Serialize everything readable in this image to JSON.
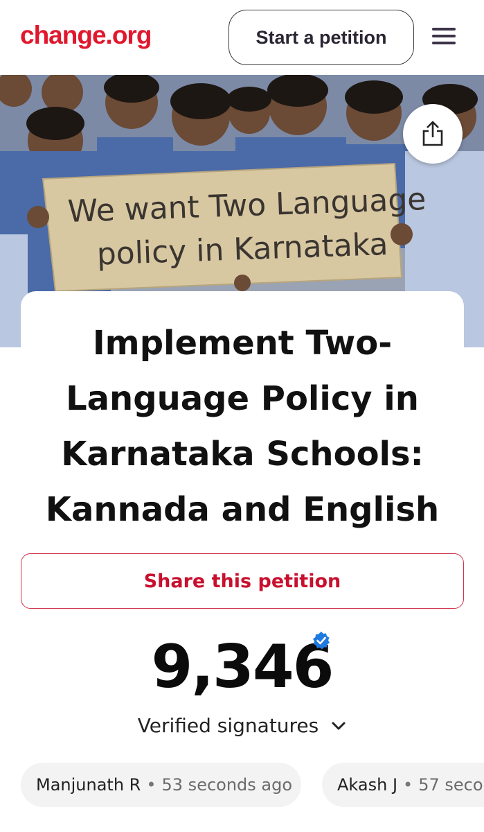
{
  "header": {
    "logo": "change.org",
    "start_petition_label": "Start a petition",
    "menu_icon": "hamburger-menu-icon"
  },
  "hero": {
    "sign_text_line1": "We want Two Language",
    "sign_text_line2": "policy in Karnataka",
    "share_icon": "share-icon"
  },
  "petition": {
    "title_lines": [
      "Implement Two-",
      "Language Policy in",
      "Karnataka Schools:",
      "Kannada and English"
    ],
    "share_label": "Share this petition",
    "signature_count": "9,346",
    "verified_label": "Verified signatures",
    "verified_icon": "verified-badge-icon",
    "dropdown_icon": "chevron-down-icon"
  },
  "recent_signers": [
    {
      "name": "Manjunath R",
      "separator": "•",
      "time": "53 seconds ago"
    },
    {
      "name": "Akash J",
      "separator": "•",
      "time": "57 secon"
    }
  ],
  "colors": {
    "brand_red": "#e0182d",
    "verified_blue": "#1f7ae0"
  }
}
